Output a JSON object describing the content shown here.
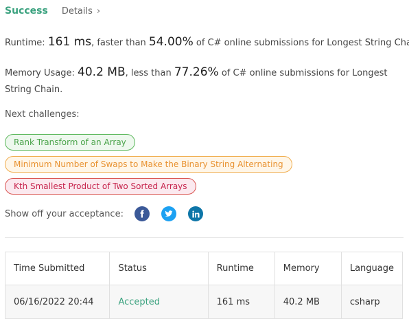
{
  "header": {
    "status": "Success",
    "details_label": "Details",
    "details_chevron": "›"
  },
  "runtime": {
    "label": "Runtime: ",
    "value": "161 ms",
    "comparison": ", faster than ",
    "percent": "54.00%",
    "suffix": " of C# online submissions for Longest String Chain."
  },
  "memory": {
    "label": "Memory Usage: ",
    "value": "40.2 MB",
    "comparison": ", less than ",
    "percent": "77.26%",
    "suffix": " of C# online submissions for Longest String Chain."
  },
  "next_challenges": {
    "label": "Next challenges:",
    "items": [
      "Rank Transform of an Array",
      "Minimum Number of Swaps to Make the Binary String Alternating",
      "Kth Smallest Product of Two Sorted Arrays"
    ]
  },
  "share": {
    "label": "Show off your acceptance:",
    "icons": [
      "facebook-icon",
      "twitter-icon",
      "linkedin-icon"
    ],
    "colors": {
      "facebook": "#3b5998",
      "twitter": "#1da1f2",
      "linkedin": "#0e76a8"
    }
  },
  "table": {
    "headers": [
      "Time Submitted",
      "Status",
      "Runtime",
      "Memory",
      "Language"
    ],
    "rows": [
      [
        "06/16/2022 20:44",
        "Accepted",
        "161 ms",
        "40.2 MB",
        "csharp"
      ]
    ]
  },
  "colors": {
    "success": "#3ba27f",
    "accepted": "#3ba27f"
  }
}
